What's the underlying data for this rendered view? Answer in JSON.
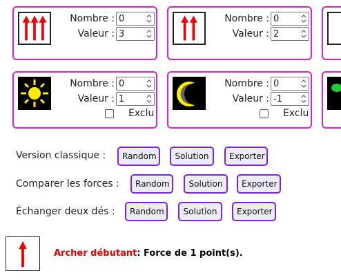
{
  "labels": {
    "nombre": "Nombre :",
    "valeur": "Valeur :",
    "exclu": "Exclu"
  },
  "cards_row1": [
    {
      "icon": "three-arrows-icon",
      "nombre": "0",
      "valeur": "3"
    },
    {
      "icon": "two-arrows-icon",
      "nombre": "0",
      "valeur": "2"
    }
  ],
  "cards_row2": [
    {
      "icon": "sun-icon",
      "nombre": "0",
      "valeur": "1"
    },
    {
      "icon": "moon-icon",
      "nombre": "0",
      "valeur": "-1"
    }
  ],
  "rows": [
    {
      "label": "Version classique :",
      "buttons": [
        "Random",
        "Solution",
        "Exporter"
      ]
    },
    {
      "label": "Comparer les forces :",
      "buttons": [
        "Random",
        "Solution",
        "Exporter"
      ]
    },
    {
      "label": "Échanger deux dés :",
      "buttons": [
        "Random",
        "Solution",
        "Exporter"
      ]
    }
  ],
  "unit": {
    "icon": "single-arrow-icon",
    "name": "Archer débutant",
    "description": ": Force de 1 point(s)."
  },
  "colors": {
    "card_border": "#e020c8",
    "button_border": "#7a22dd",
    "arrow": "#ee0000",
    "sun": "#ffee00",
    "moon": "#ffee00"
  }
}
